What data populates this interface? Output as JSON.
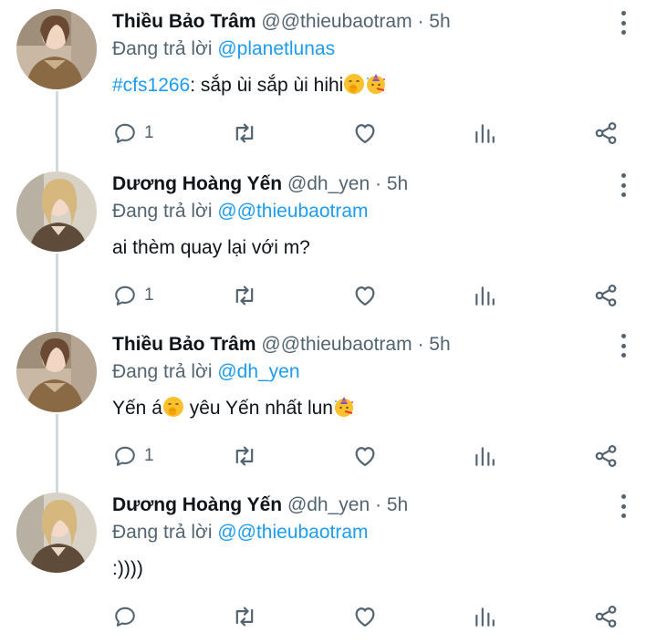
{
  "tweets": [
    {
      "name": "Thiều Bảo Trâm",
      "handle": "@@thieubaotram",
      "dot": "·",
      "time": "5h",
      "reply_prefix": "Đang trả lời",
      "reply_to": "@planetlunas",
      "text_hashtag": "#cfs1266",
      "text": ": sắp ùi sắp ùi hihi",
      "emojis": [
        "shushing-face-emoji",
        "party-face-emoji"
      ],
      "reply_count": "1",
      "avatar": "avatar-tram"
    },
    {
      "name": "Dương Hoàng Yến",
      "handle": "@dh_yen",
      "dot": "·",
      "time": "5h",
      "reply_prefix": "Đang trả lời",
      "reply_to": "@@thieubaotram",
      "text": "ai thèm quay lại với m?",
      "reply_count": "1",
      "avatar": "avatar-yen"
    },
    {
      "name": "Thiều Bảo Trâm",
      "handle": "@@thieubaotram",
      "dot": "·",
      "time": "5h",
      "reply_prefix": "Đang trả lời",
      "reply_to": "@dh_yen",
      "text_a": "Yến á",
      "text_b": " yêu Yến nhất lun",
      "emojis": [
        "shushing-face-emoji",
        "party-face-emoji"
      ],
      "reply_count": "1",
      "avatar": "avatar-tram"
    },
    {
      "name": "Dương Hoàng Yến",
      "handle": "@dh_yen",
      "dot": "·",
      "time": "5h",
      "reply_prefix": "Đang trả lời",
      "reply_to": "@@thieubaotram",
      "text": ":))))",
      "reply_count": "",
      "avatar": "avatar-yen"
    }
  ],
  "icons": [
    "reply-icon",
    "retweet-icon",
    "like-icon",
    "analytics-icon",
    "share-icon",
    "more-icon"
  ],
  "colors": {
    "link": "#1d9bf0",
    "muted": "#536471",
    "text": "#0f1419",
    "thread": "#cfd9de"
  }
}
